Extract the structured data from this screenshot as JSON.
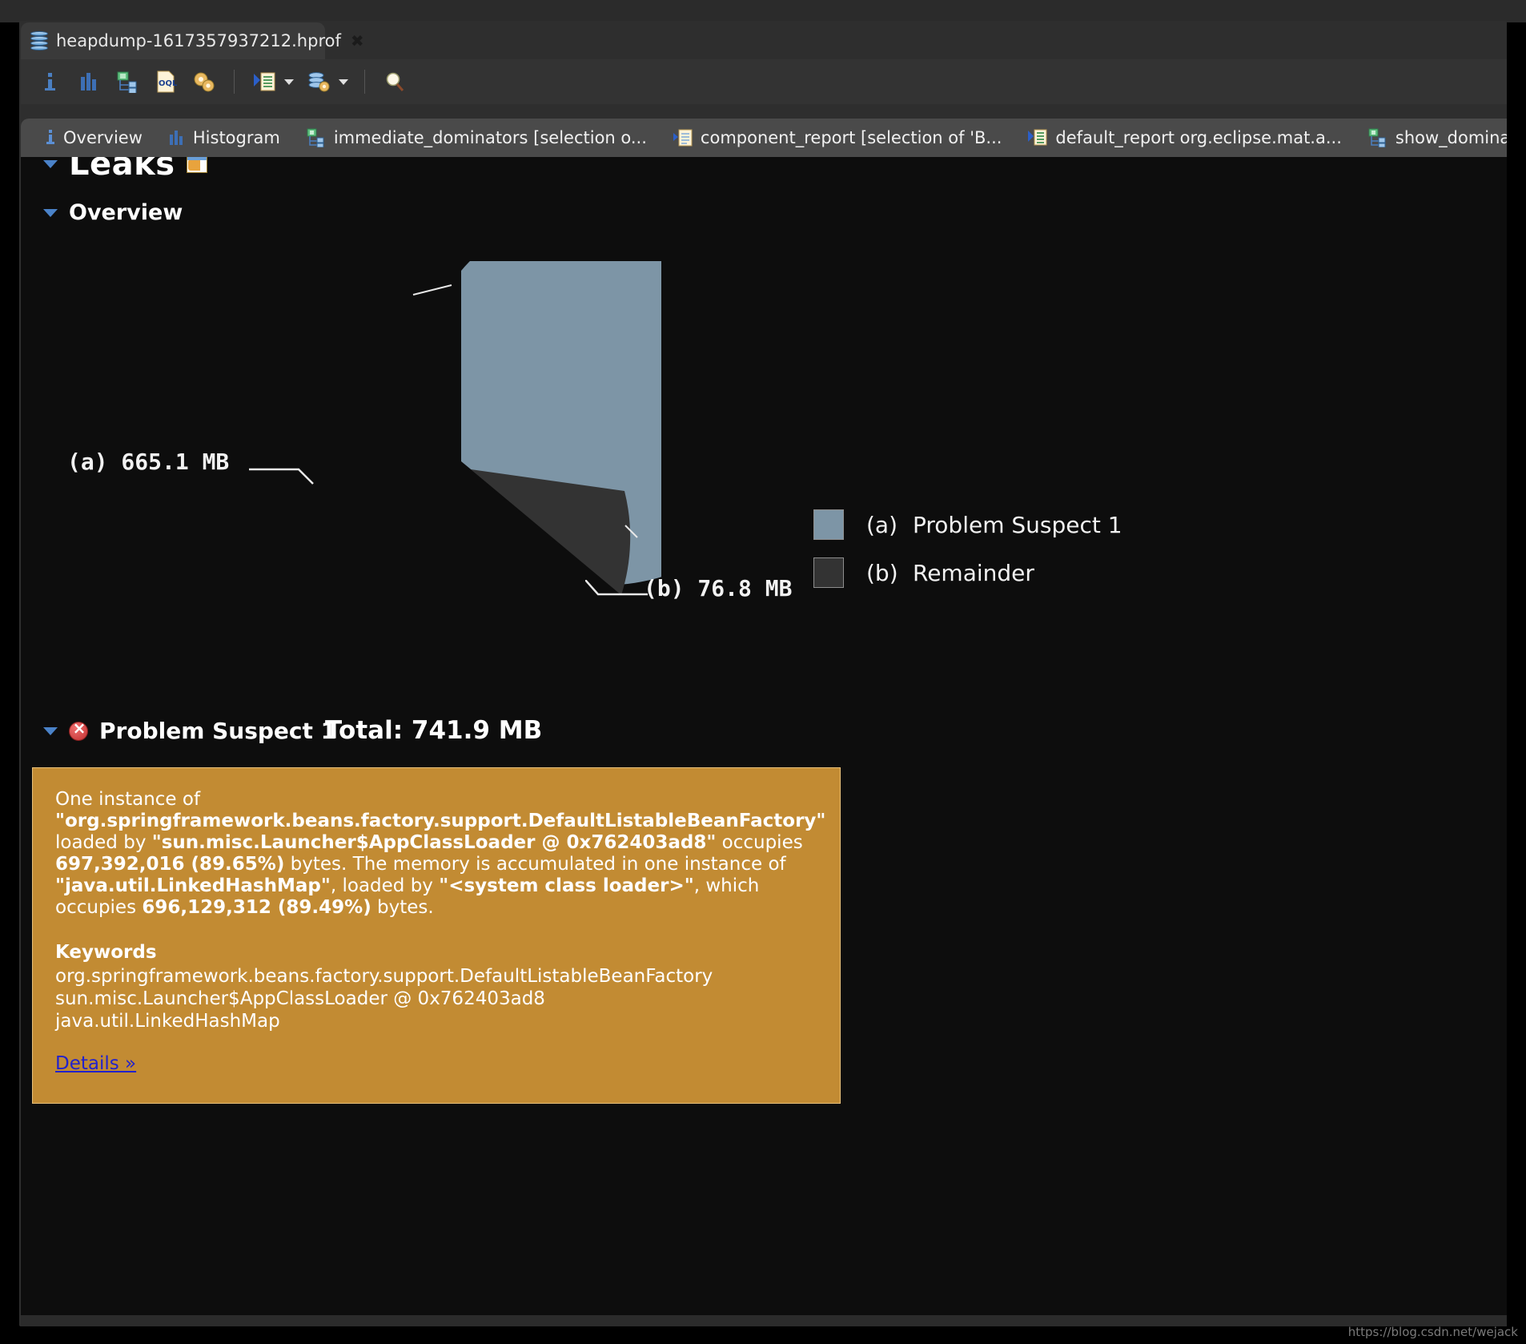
{
  "window": {
    "file_tab": {
      "label": "heapdump-1617357937212.hprof",
      "icon": "heapdump-icon",
      "close_icon": "close-icon"
    }
  },
  "toolbar": {
    "buttons": [
      {
        "name": "info-button",
        "icon": "info-icon",
        "glyph": "i"
      },
      {
        "name": "histogram-button",
        "icon": "histogram-icon",
        "glyph": "bars"
      },
      {
        "name": "dominator-tree-button",
        "icon": "dominator-tree-icon",
        "glyph": "tree"
      },
      {
        "name": "oql-button",
        "icon": "oql-icon",
        "glyph": "OQL"
      },
      {
        "name": "thread-overview-button",
        "icon": "gears-icon",
        "glyph": "gears"
      },
      {
        "name": "run-report-button",
        "icon": "run-report-icon",
        "glyph": "report"
      },
      {
        "name": "query-browser-button",
        "icon": "heap-gear-icon",
        "glyph": "heapgear"
      },
      {
        "name": "search-button",
        "icon": "search-icon",
        "glyph": "magnifier"
      }
    ]
  },
  "subtabs": [
    {
      "label": "Overview",
      "icon": "info-icon",
      "active": true
    },
    {
      "label": "Histogram",
      "icon": "histogram-icon",
      "active": false
    },
    {
      "label": "immediate_dominators [selection o...",
      "icon": "dominator-tree-icon",
      "active": false
    },
    {
      "label": "component_report [selection of 'B...",
      "icon": "report-icon",
      "active": false
    },
    {
      "label": "default_report org.eclipse.mat.a...",
      "icon": "run-report-icon",
      "active": false
    },
    {
      "label": "show_dominato",
      "icon": "dominator-tree-icon",
      "active": false
    }
  ],
  "sections": {
    "leaks": {
      "title": "Leaks",
      "icon": "leaks-icon",
      "expanded": true
    },
    "overview": {
      "title": "Overview",
      "expanded": true
    },
    "problem_suspect": {
      "title": "Problem Suspect 1",
      "icon": "error-icon",
      "expanded": true
    }
  },
  "chart_data": {
    "type": "pie",
    "title": "",
    "total_label": "Total: 741.9 MB",
    "total_value": 741.9,
    "unit": "MB",
    "categories": [
      "(a) Problem Suspect 1",
      "(b) Remainder"
    ],
    "values": [
      665.1,
      76.8
    ],
    "value_labels": [
      "(a) 665.1 MB",
      "(b) 76.8 MB"
    ],
    "colors": [
      "#7d95a6",
      "#333333"
    ],
    "legend_position": "right",
    "legend": [
      {
        "key": "(a)",
        "label": "Problem Suspect 1",
        "color": "#7d95a6"
      },
      {
        "key": "(b)",
        "label": "Remainder",
        "color": "#333333"
      }
    ],
    "exploded_slice": 1,
    "grid": false
  },
  "suspect_detail": {
    "paragraph_parts": [
      {
        "text": "One instance of ",
        "bold": false
      },
      {
        "text": "\"org.springframework.beans.factory.support.DefaultListableBeanFactory\"",
        "bold": true
      },
      {
        "text": " loaded by ",
        "bold": false
      },
      {
        "text": "\"sun.misc.Launcher$AppClassLoader @ 0x762403ad8\"",
        "bold": true
      },
      {
        "text": " occupies ",
        "bold": false
      },
      {
        "text": "697,392,016 (89.65%)",
        "bold": true
      },
      {
        "text": " bytes. The memory is accumulated in one instance of ",
        "bold": false
      },
      {
        "text": "\"java.util.LinkedHashMap\"",
        "bold": true
      },
      {
        "text": ", loaded by ",
        "bold": false
      },
      {
        "text": "\"<system class loader>\"",
        "bold": true
      },
      {
        "text": ", which occupies ",
        "bold": false
      },
      {
        "text": "696,129,312 (89.49%)",
        "bold": true
      },
      {
        "text": " bytes.",
        "bold": false
      }
    ],
    "keywords_title": "Keywords",
    "keywords": [
      "org.springframework.beans.factory.support.DefaultListableBeanFactory",
      "sun.misc.Launcher$AppClassLoader @ 0x762403ad8",
      "java.util.LinkedHashMap"
    ],
    "details_link": "Details »",
    "box_color": "#c28b33"
  },
  "watermark": "https://blog.csdn.net/wejack"
}
